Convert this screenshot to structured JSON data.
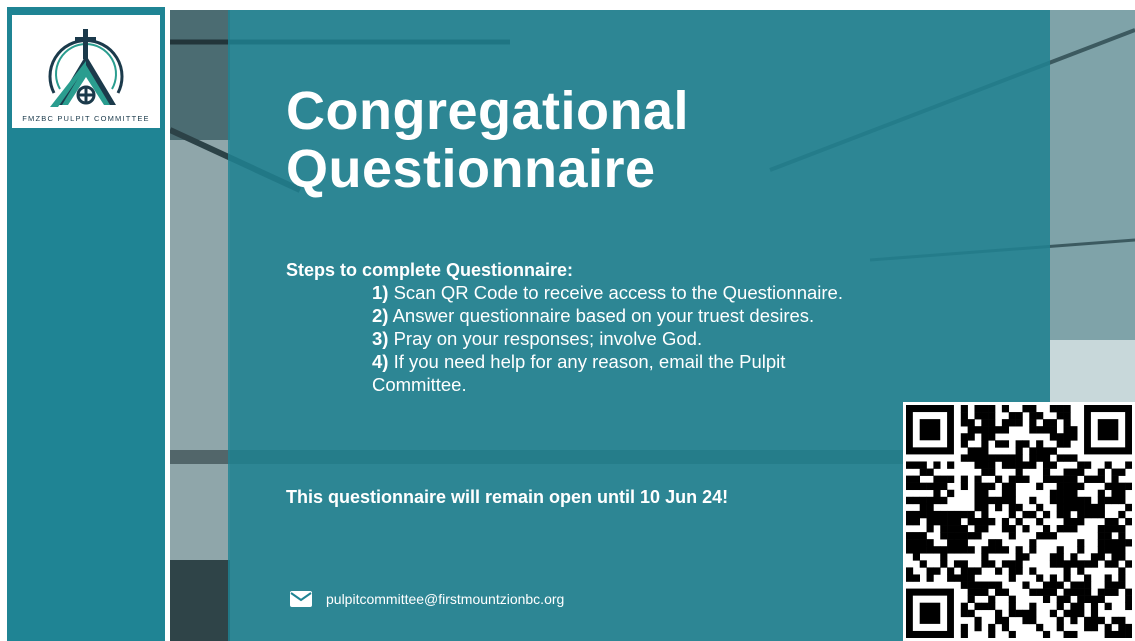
{
  "logo": {
    "text": "FMZBC PULPIT COMMITTEE",
    "icon": "church-steeple-cross"
  },
  "colors": {
    "teal": "#1f8494",
    "dark_teal": "#17606b",
    "text": "#ffffff"
  },
  "slide": {
    "title_line1": "Congregational",
    "title_line2": "Questionnaire",
    "steps_heading": "Steps to complete Questionnaire:",
    "steps": [
      {
        "num": "1)",
        "text": " Scan QR Code to receive access to the Questionnaire."
      },
      {
        "num": "2)",
        "text": " Answer questionnaire based on your truest desires."
      },
      {
        "num": "3)",
        "text": " Pray on your responses; involve God."
      },
      {
        "num": "4)",
        "text": " If you need help for any reason, email the Pulpit Committee."
      }
    ],
    "deadline": "This questionnaire will remain open until 10 Jun 24!",
    "email": "pulpitcommittee@firstmountzionbc.org",
    "email_icon": "envelope-icon",
    "qr_icon": "qr-code"
  }
}
